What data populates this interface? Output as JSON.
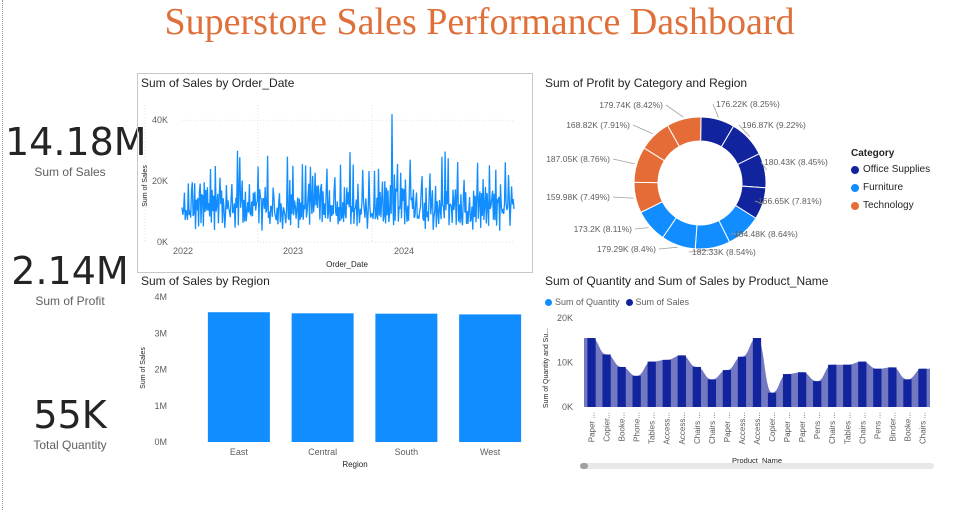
{
  "title": "Superstore Sales Performance Dashboard",
  "kpis": [
    {
      "value": "14.18M",
      "label": "Sum of Sales"
    },
    {
      "value": "2.14M",
      "label": "Sum of Profit"
    },
    {
      "value": "55K",
      "label": "Total Quantity"
    }
  ],
  "colors": {
    "title": "#e0703a",
    "blue": "#118dff",
    "navy": "#12239e",
    "orange": "#e66c37"
  },
  "chart_data": [
    {
      "id": "sales_by_date",
      "type": "line",
      "title": "Sum of Sales by Order_Date",
      "xlabel": "Order_Date",
      "ylabel": "Sum of Sales",
      "x_ticks": [
        "2022",
        "2023",
        "2024"
      ],
      "y_ticks": [
        "0K",
        "20K",
        "40K"
      ],
      "ylim": [
        0,
        45000
      ],
      "x_range": [
        "2021-10",
        "2025-01"
      ],
      "series": [
        {
          "color": "#118dff",
          "typical_range": [
            5000,
            22000
          ],
          "values_sample": [
            12000,
            9000,
            15000,
            21000,
            8000,
            11000,
            14000,
            6000,
            19000,
            10000,
            13000,
            7000,
            16000,
            30000,
            9000,
            12000,
            18000,
            6000,
            14000,
            11000,
            20000,
            8000,
            13000,
            15000,
            9000,
            17000,
            12000,
            7000,
            22000,
            10000,
            16000,
            13000,
            25000,
            8000,
            14000,
            11000,
            42000,
            9000,
            15000,
            12000,
            18000,
            6000,
            20000,
            13000,
            10000,
            17000,
            8000,
            14000,
            24000,
            11000,
            16000,
            9000,
            19000,
            12000,
            7000,
            15000,
            21000,
            10000,
            13000,
            9000
          ]
        }
      ]
    },
    {
      "id": "profit_by_category_region",
      "type": "pie",
      "title": "Sum of Profit by Category and Region",
      "legend_title": "Category",
      "legend_position": "right",
      "legend": [
        {
          "name": "Office Supplies",
          "color": "#12239e"
        },
        {
          "name": "Furniture",
          "color": "#118dff"
        },
        {
          "name": "Technology",
          "color": "#e66c37"
        }
      ],
      "slices": [
        {
          "label": "176.22K (8.25%)",
          "value": 176220,
          "category": "Office Supplies"
        },
        {
          "label": "196.87K (9.22%)",
          "value": 196870,
          "category": "Office Supplies"
        },
        {
          "label": "180.43K (8.45%)",
          "value": 180430,
          "category": "Office Supplies"
        },
        {
          "label": "166.65K (7.81%)",
          "value": 166650,
          "category": "Office Supplies"
        },
        {
          "label": "184.48K (8.64%)",
          "value": 184480,
          "category": "Furniture"
        },
        {
          "label": "182.33K (8.54%)",
          "value": 182330,
          "category": "Furniture"
        },
        {
          "label": "179.29K (8.4%)",
          "value": 179290,
          "category": "Furniture"
        },
        {
          "label": "173.2K (8.11%)",
          "value": 173200,
          "category": "Furniture"
        },
        {
          "label": "159.98K (7.49%)",
          "value": 159980,
          "category": "Technology"
        },
        {
          "label": "187.05K (8.76%)",
          "value": 187050,
          "category": "Technology"
        },
        {
          "label": "168.82K (7.91%)",
          "value": 168820,
          "category": "Technology"
        },
        {
          "label": "179.74K (8.42%)",
          "value": 179740,
          "category": "Technology"
        }
      ]
    },
    {
      "id": "sales_by_region",
      "type": "bar",
      "title": "Sum of Sales by Region",
      "xlabel": "Region",
      "ylabel": "Sum of Sales",
      "categories": [
        "East",
        "Central",
        "South",
        "West"
      ],
      "values": [
        3580000,
        3550000,
        3540000,
        3520000
      ],
      "y_ticks": [
        "0M",
        "1M",
        "2M",
        "3M",
        "4M"
      ],
      "ylim": [
        0,
        4000000
      ],
      "color": "#118dff"
    },
    {
      "id": "qty_sales_by_product",
      "type": "area",
      "title": "Sum of Quantity and Sum of Sales by Product_Name",
      "xlabel": "Product_Name",
      "ylabel": "Sum of Quantity and Su...",
      "y_ticks": [
        "0K",
        "10K",
        "20K"
      ],
      "ylim": [
        0,
        20000
      ],
      "legend": [
        {
          "name": "Sum of Quantity",
          "color": "#118dff"
        },
        {
          "name": "Sum of Sales",
          "color": "#12239e"
        }
      ],
      "categories": [
        "Paper ...",
        "Copier...",
        "Booke...",
        "Phone...",
        "Tables ...",
        "Access...",
        "Access...",
        "Chairs ...",
        "Chairs ...",
        "Paper ...",
        "Access...",
        "Access...",
        "Copier...",
        "Paper ...",
        "Paper ...",
        "Pens ...",
        "Chairs ...",
        "Tables ...",
        "Chairs ...",
        "Pens ...",
        "Binder...",
        "Booke...",
        "Chairs ..."
      ],
      "values": [
        15500,
        11800,
        9000,
        7000,
        10200,
        10600,
        11600,
        9000,
        6200,
        8300,
        11300,
        15500,
        3200,
        7400,
        7800,
        5800,
        9500,
        9500,
        10200,
        8600,
        8900,
        6200,
        8600
      ]
    }
  ]
}
